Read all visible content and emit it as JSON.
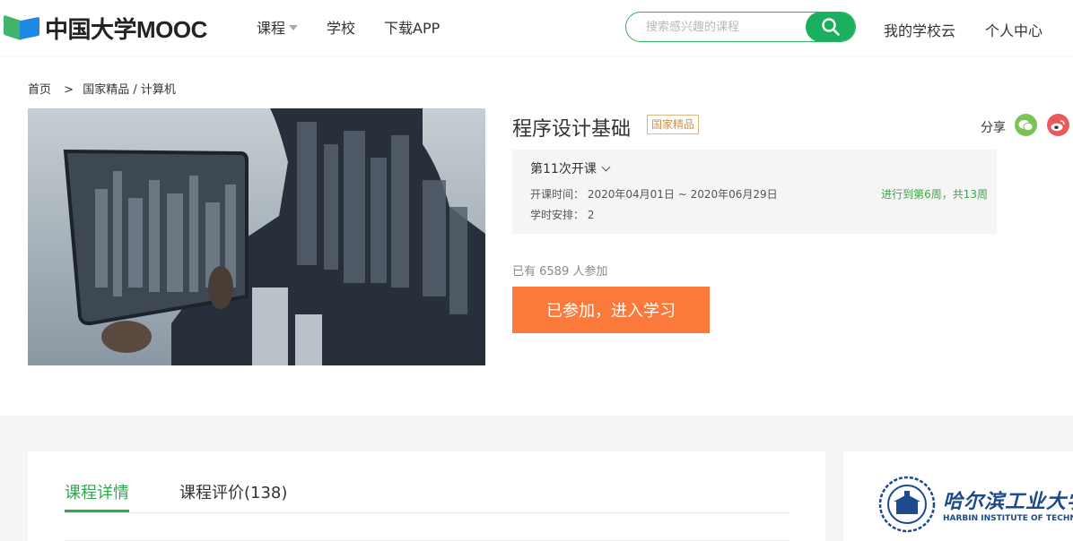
{
  "header": {
    "logo_text": "中国大学MOOC",
    "nav": [
      "课程",
      "学校",
      "下载APP"
    ],
    "search_placeholder": "搜索感兴趣的课程",
    "my_school_cloud": "我的学校云",
    "personal_center": "个人中心"
  },
  "breadcrumb": {
    "home": "首页",
    "separator": ">",
    "path": "国家精品 / 计算机"
  },
  "course": {
    "title": "程序设计基础",
    "tag": "国家精品",
    "share_label": "分享",
    "term_label": "第11次开课",
    "time_label": "开课时间：",
    "time_value": "2020年04月01日 ~ 2020年06月29日",
    "schedule_label": "学时安排：",
    "schedule_value": "2",
    "progress": "进行到第6周，共13周",
    "joined_text": "已有 6589 人参加",
    "enter_button": "已参加，进入学习"
  },
  "tabs": {
    "detail": "课程详情",
    "reviews": "课程评价(138)"
  },
  "school": {
    "name_cn": "哈尔滨工业大学",
    "name_en": "HARBIN INSTITUTE OF TECHNOLOGY"
  },
  "colors": {
    "brand_green": "#1aaf5d",
    "accent_orange": "#fb7a3b",
    "tag_gold": "#c99550",
    "progress_green": "#39a845"
  }
}
